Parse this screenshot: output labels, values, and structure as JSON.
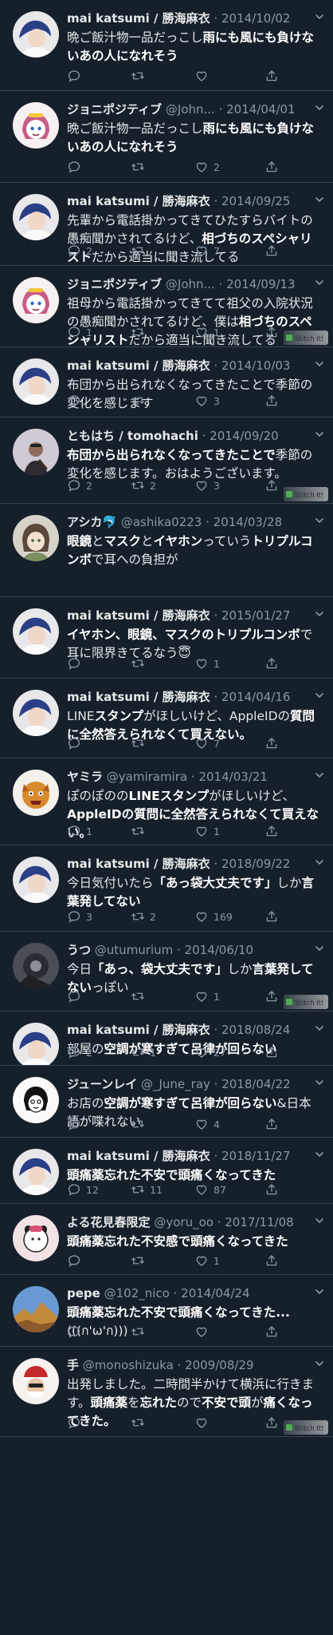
{
  "tweets": [
    {
      "name": "mai katsumi / 勝海麻衣",
      "handle": "",
      "date": "2014/10/02",
      "avatar": "mai",
      "segments": [
        {
          "t": "晩ご飯汁物一品だっこし",
          "b": false
        },
        {
          "t": "雨にも風にも負けないあの人になれそう",
          "b": true
        }
      ],
      "reply": "",
      "rt": "",
      "like": "",
      "stitch": false
    },
    {
      "name": "ジョニポジティブ",
      "handle": "@John...",
      "date": "2014/04/01",
      "avatar": "popuko",
      "segments": [
        {
          "t": "晩ご飯汁物一品だっこし",
          "b": false
        },
        {
          "t": "雨にも風にも負けないあの人になれそう",
          "b": true
        }
      ],
      "reply": "",
      "rt": "",
      "like": "2",
      "stitch": false
    },
    {
      "name": "mai katsumi / 勝海麻衣",
      "handle": "",
      "date": "2014/09/25",
      "avatar": "mai",
      "segments": [
        {
          "t": "先輩から電話掛かってきてひたすらバイトの愚痴聞かされてるけど、",
          "b": false
        },
        {
          "t": "相づちのスペシャリスト",
          "b": true
        },
        {
          "t": "だから適当に聞き流してる",
          "b": false
        }
      ],
      "reply": "2",
      "rt": "",
      "like": "7",
      "stitch": false
    },
    {
      "name": "ジョニポジティブ",
      "handle": "@John...",
      "date": "2014/09/13",
      "avatar": "popuko",
      "segments": [
        {
          "t": "祖母から電話掛かってきてて祖父の入院状況の愚痴聞かされてるけど、僕は",
          "b": false
        },
        {
          "t": "相づちのスペシャリスト",
          "b": true
        },
        {
          "t": "だから適当に聞き流してる",
          "b": false
        }
      ],
      "reply": "1",
      "rt": "",
      "like": "1",
      "stitch": true
    },
    {
      "name": "mai katsumi / 勝海麻衣",
      "handle": "",
      "date": "2014/10/03",
      "avatar": "mai",
      "segments": [
        {
          "t": "布団から出られなくなってきたことで季節の変化を感じます",
          "b": false
        }
      ],
      "reply": "",
      "rt": "",
      "like": "3",
      "stitch": false
    },
    {
      "name": "ともはち / tomohachi",
      "handle": "",
      "date": "2014/09/20",
      "avatar": "tomo",
      "segments": [
        {
          "t": "布団から出られなくなってきたことで",
          "b": true
        },
        {
          "t": "季節の変化を感じます。おはようございます。",
          "b": false
        }
      ],
      "reply": "2",
      "rt": "2",
      "like": "3",
      "stitch": true
    },
    {
      "name": "アシカ🐬",
      "handle": "@ashika0223",
      "date": "2014/03/28",
      "avatar": "ashika",
      "segments": [
        {
          "t": "眼鏡",
          "b": true
        },
        {
          "t": "と",
          "b": false
        },
        {
          "t": "マスク",
          "b": true
        },
        {
          "t": "と",
          "b": false
        },
        {
          "t": "イヤホン",
          "b": true
        },
        {
          "t": "っていう",
          "b": false
        },
        {
          "t": "トリプルコンボ",
          "b": true
        },
        {
          "t": "で耳への負担が",
          "b": false
        }
      ],
      "reply": "",
      "rt": "",
      "like": "",
      "stitch": false
    },
    {
      "name": "mai katsumi / 勝海麻衣",
      "handle": "",
      "date": "2015/01/27",
      "avatar": "mai",
      "segments": [
        {
          "t": "イヤホン、眼鏡、マスクのトリプルコンボ",
          "b": true
        },
        {
          "t": "で耳に限界きてるなう😇",
          "b": false
        }
      ],
      "reply": "",
      "rt": "",
      "like": "1",
      "stitch": false
    },
    {
      "name": "mai katsumi / 勝海麻衣",
      "handle": "",
      "date": "2014/04/16",
      "avatar": "mai",
      "segments": [
        {
          "t": "LINE",
          "b": false
        },
        {
          "t": "スタンプ",
          "b": true
        },
        {
          "t": "がほしいけど、AppleIDの",
          "b": false
        },
        {
          "t": "質問に全然答えられなくて買えない。",
          "b": true
        }
      ],
      "reply": "",
      "rt": "",
      "like": "7",
      "stitch": false
    },
    {
      "name": "ヤミラ",
      "handle": "@yamiramira",
      "date": "2014/03/21",
      "avatar": "yamira",
      "segments": [
        {
          "t": "ぽのぽのの",
          "b": false
        },
        {
          "t": "LINEスタンプ",
          "b": true
        },
        {
          "t": "がほしいけど、",
          "b": false
        },
        {
          "t": "AppleIDの質問に全然答えられなくて買えない。",
          "b": true
        }
      ],
      "reply": "1",
      "rt": "",
      "like": "1",
      "stitch": false
    },
    {
      "name": "mai katsumi / 勝海麻衣",
      "handle": "",
      "date": "2018/09/22",
      "avatar": "mai",
      "segments": [
        {
          "t": "今日気付いたら",
          "b": false
        },
        {
          "t": "「あっ袋大丈夫です」",
          "b": true
        },
        {
          "t": "しか",
          "b": false
        },
        {
          "t": "言葉発してない",
          "b": true
        }
      ],
      "reply": "3",
      "rt": "2",
      "like": "169",
      "stitch": false
    },
    {
      "name": "うつ",
      "handle": "@utumurium",
      "date": "2014/06/10",
      "avatar": "utsu",
      "segments": [
        {
          "t": "今日",
          "b": false
        },
        {
          "t": "「あっ、袋大丈夫です」",
          "b": true
        },
        {
          "t": "しか",
          "b": false
        },
        {
          "t": "言葉発してない",
          "b": true
        },
        {
          "t": "っぽい",
          "b": false
        }
      ],
      "reply": "",
      "rt": "",
      "like": "1",
      "stitch": true
    },
    {
      "name": "mai katsumi / 勝海麻衣",
      "handle": "",
      "date": "2018/08/24",
      "avatar": "mai",
      "segments": [
        {
          "t": "部屋の",
          "b": false
        },
        {
          "t": "空調が寒すぎて",
          "b": true
        },
        {
          "t": "呂律が回らない",
          "b": true
        }
      ],
      "reply": "2",
      "rt": "1",
      "like": "27",
      "stitch": false
    },
    {
      "name": "ジューンレイ",
      "handle": "@_June_ray",
      "date": "2018/04/22",
      "avatar": "june",
      "segments": [
        {
          "t": "お店の",
          "b": false
        },
        {
          "t": "空調が寒すぎて呂律が回らない",
          "b": true
        },
        {
          "t": "&日本語が喋れない",
          "b": false
        }
      ],
      "reply": "",
      "rt": "",
      "like": "4",
      "stitch": false
    },
    {
      "name": "mai katsumi / 勝海麻衣",
      "handle": "",
      "date": "2018/11/27",
      "avatar": "mai",
      "segments": [
        {
          "t": "頭痛薬忘れた不安で頭痛くなってきた",
          "b": true
        }
      ],
      "reply": "12",
      "rt": "11",
      "like": "87",
      "stitch": false
    },
    {
      "name": "よる花見春限定",
      "handle": "@yoru_oo",
      "date": "2017/11/08",
      "avatar": "yoru",
      "segments": [
        {
          "t": "頭痛薬忘れた不安感で頭痛くなってきた",
          "b": true
        }
      ],
      "reply": "",
      "rt": "",
      "like": "1",
      "stitch": false
    },
    {
      "name": "pepe",
      "handle": "@102_nico",
      "date": "2014/04/24",
      "avatar": "pepe",
      "segments": [
        {
          "t": "頭痛薬忘れた不安で頭痛くなってきた...",
          "b": true
        },
        {
          "t": "(((ก'ω'ก)))",
          "b": false
        }
      ],
      "reply": "",
      "rt": "",
      "like": "",
      "stitch": false
    },
    {
      "name": "手",
      "handle": "@monoshizuka",
      "date": "2009/08/29",
      "avatar": "te",
      "segments": [
        {
          "t": "出発しました。二時間半かけて横浜に行きます。",
          "b": false
        },
        {
          "t": "頭痛薬",
          "b": true
        },
        {
          "t": "を",
          "b": false
        },
        {
          "t": "忘れた",
          "b": true
        },
        {
          "t": "ので",
          "b": false
        },
        {
          "t": "不安で頭",
          "b": true
        },
        {
          "t": "が",
          "b": false
        },
        {
          "t": "痛くなってきた。",
          "b": true
        }
      ],
      "reply": "",
      "rt": "",
      "like": "",
      "stitch": true
    }
  ],
  "watermark": "Stitch It!",
  "separator": "·",
  "colors": {
    "bg": "#15202b",
    "text": "#e7e9ea",
    "muted": "#8b98a5",
    "border": "#38444d"
  }
}
